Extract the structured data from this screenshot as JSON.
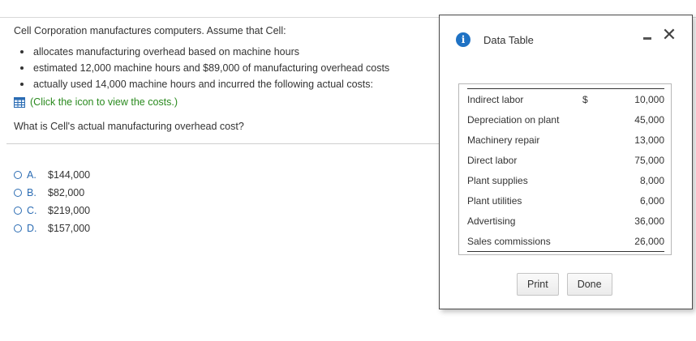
{
  "question": {
    "intro": "Cell Corporation manufactures computers. Assume that Cell:",
    "bullets": [
      "allocates manufacturing overhead based on machine hours",
      "estimated 12,000 machine hours and $89,000 of manufacturing overhead costs",
      "actually used 14,000 machine hours and incurred the following actual costs:"
    ],
    "view_costs_link": "(Click the icon to view the costs.)",
    "ask": "What is Cell's actual manufacturing overhead cost?"
  },
  "options": [
    {
      "letter": "A.",
      "value": "$144,000"
    },
    {
      "letter": "B.",
      "value": "$82,000"
    },
    {
      "letter": "C.",
      "value": "$219,000"
    },
    {
      "letter": "D.",
      "value": "$157,000"
    }
  ],
  "dialog": {
    "title": "Data Table",
    "icons": {
      "info": "info-icon",
      "minimize": "minimize-icon",
      "close": "close-icon"
    },
    "close_glyph": "✕",
    "rows": [
      {
        "label": "Indirect labor",
        "symbol": "$",
        "amount": "10,000"
      },
      {
        "label": "Depreciation on plant",
        "symbol": "",
        "amount": "45,000"
      },
      {
        "label": "Machinery repair",
        "symbol": "",
        "amount": "13,000"
      },
      {
        "label": "Direct labor",
        "symbol": "",
        "amount": "75,000"
      },
      {
        "label": "Plant supplies",
        "symbol": "",
        "amount": "8,000"
      },
      {
        "label": "Plant utilities",
        "symbol": "",
        "amount": "6,000"
      },
      {
        "label": "Advertising",
        "symbol": "",
        "amount": "36,000"
      },
      {
        "label": "Sales commissions",
        "symbol": "",
        "amount": "26,000"
      }
    ],
    "print_label": "Print",
    "done_label": "Done"
  },
  "colors": {
    "link_green": "#2a8a1e",
    "radio_blue": "#2b6cb3",
    "info_blue": "#1f72c4"
  }
}
